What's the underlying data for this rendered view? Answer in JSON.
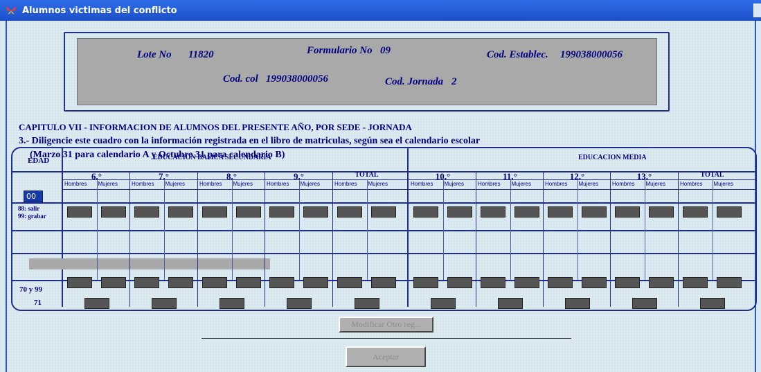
{
  "window": {
    "title": "Alumnos victimas del conflicto"
  },
  "header": {
    "lote_label": "Lote No",
    "lote_value": "11820",
    "formulario_label": "Formulario No",
    "formulario_value": "09",
    "codestab_label": "Cod. Establec.",
    "codestab_value": "199038000056",
    "codcol_label": "Cod. col",
    "codcol_value": "199038000056",
    "codjornada_label": "Cod. Jornada",
    "codjornada_value": "2"
  },
  "chapter_title": "CAPITULO VII - INFORMACION DE ALUMNOS DEL PRESENTE AÑO, POR SEDE - JORNADA",
  "instruction_line1": "3.- Diligencie este cuadro con la información registrada en el libro de matriculas, según sea el calendario escolar",
  "instruction_line2": "(Marzo 31 para calendario A y  Octubre 31 para calendario B)",
  "table": {
    "edad_label": "EDAD",
    "edad_value": "00",
    "salir_label": "88: salir",
    "grabar_label": "99: grabar",
    "secundaria_label": "EDUCACION BASICA SECUNDARIA",
    "media_label": "EDUCACION  MEDIA",
    "grades": [
      "6.°",
      "7.°",
      "8.°",
      "9.°",
      "TOTAL",
      "10.°",
      "11.°",
      "12.°",
      "13.°",
      "TOTAL"
    ],
    "hombres_label": "Hombres",
    "mujeres_label": "Mujeres",
    "row_70_99": "70 y 99",
    "row_71": "71"
  },
  "buttons": {
    "modificar": "Modificar Otro reg...",
    "aceptar": "Aceptar"
  },
  "colors": {
    "title_bar": "#2e6ee8",
    "text_blue": "#000080",
    "field_gray": "#555555"
  }
}
